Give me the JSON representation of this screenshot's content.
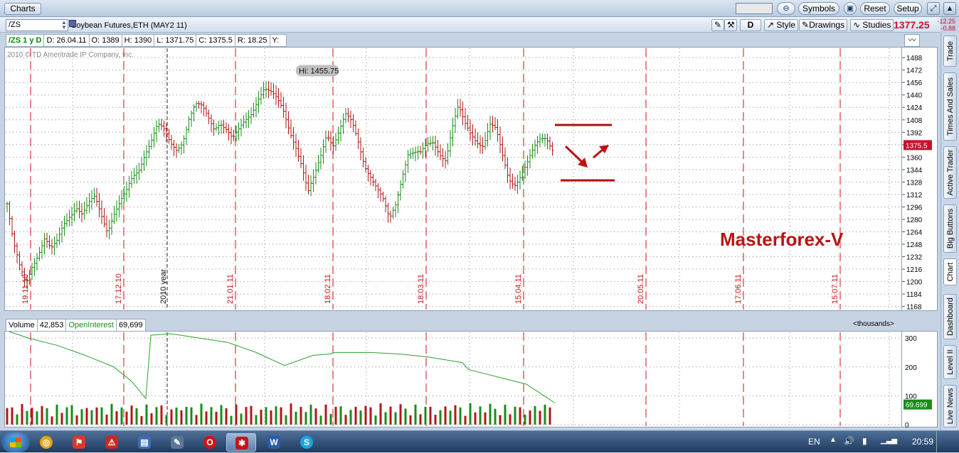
{
  "window": {
    "tab_label": "Charts",
    "buttons": {
      "symbols": "Symbols",
      "reset": "Reset",
      "setup": "Setup"
    }
  },
  "toolbar": {
    "symbol_value": "/ZS",
    "description": "Soybean Futures,ETH (MAY2 11)",
    "period": "D",
    "style": "Style",
    "drawings": "Drawings",
    "studies": "Studies",
    "last_price": "1377.25",
    "net_change": "-12.25",
    "pct_change": "-0.88 %"
  },
  "info": {
    "symbol": "/ZS 1 y D",
    "date": "D: 26.04.11",
    "open": "O: 1389",
    "high": "H: 1390",
    "low": "L: 1371.75",
    "close": "C: 1375.5",
    "range": "R: 18.25",
    "y": "Y:"
  },
  "copyright": "2010 © TD Ameritrade IP Company, Inc.",
  "high_label": "Hi: 1455.75",
  "watermark": "Masterforex-V",
  "price_badge": "1375.5",
  "volume_info": {
    "label": "Volume",
    "value": "42,853",
    "oi_label": "OpenInterest",
    "oi_value": "69,699",
    "units": "<thousands>",
    "oi_badge": "69.699"
  },
  "right_tabs": [
    "Trade",
    "Times And Sales",
    "Active Trader",
    "Big Buttons",
    "Chart",
    "Dashboard",
    "Level II",
    "Live News"
  ],
  "taskbar": {
    "lang": "EN",
    "time": "20:59"
  },
  "colors": {
    "up": "#1a8c1a",
    "down": "#b01818",
    "marker": "#d01010",
    "oi": "#2e9e2e",
    "watermark": "#b81414"
  },
  "chart_data": [
    {
      "type": "candlestick",
      "title": "Soybean Futures,ETH (MAY2 11)",
      "y_ticks": [
        1488,
        1472,
        1456,
        1440,
        1424,
        1408,
        1392,
        1376,
        1360,
        1344,
        1328,
        1312,
        1296,
        1280,
        1264,
        1248,
        1232,
        1216,
        1200,
        1184,
        1168
      ],
      "ylim": [
        1164,
        1500
      ],
      "date_markers": [
        "19.11.10",
        "17.12.10",
        "21.01.11",
        "18.02.11",
        "18.03.11",
        "15.04.11",
        "20.05.11",
        "17.06.11",
        "15.07.11"
      ],
      "year_marker": "2010 year",
      "price_path": [
        1300,
        1245,
        1215,
        1198,
        1225,
        1240,
        1255,
        1236,
        1248,
        1275,
        1290,
        1300,
        1285,
        1295,
        1305,
        1288,
        1270,
        1290,
        1300,
        1310,
        1330,
        1345,
        1370,
        1385,
        1400,
        1390,
        1375,
        1372,
        1385,
        1412,
        1425,
        1420,
        1410,
        1400,
        1410,
        1398,
        1380,
        1390,
        1405,
        1420,
        1440,
        1450,
        1440,
        1430,
        1420,
        1400,
        1380,
        1350,
        1310,
        1330,
        1360,
        1395,
        1380,
        1395,
        1410,
        1400,
        1380,
        1355,
        1340,
        1320,
        1300,
        1275,
        1300,
        1340,
        1370,
        1365,
        1360,
        1372,
        1380,
        1370,
        1360,
        1395,
        1420,
        1400,
        1392,
        1385,
        1378,
        1400,
        1390,
        1360,
        1335,
        1330,
        1340,
        1350,
        1365,
        1380,
        1388,
        1376
      ],
      "high": 1455.75,
      "last": 1375.5
    },
    {
      "type": "bar",
      "title": "Volume / OpenInterest",
      "y_ticks": [
        300,
        200,
        100,
        0
      ],
      "ylim": [
        0,
        320
      ],
      "volume_pattern": [
        72,
        50,
        38,
        62,
        45,
        55,
        40,
        68,
        48,
        35,
        58,
        44,
        52,
        65,
        30,
        47,
        60,
        42
      ],
      "open_interest": [
        325,
        300,
        275,
        240,
        200,
        150,
        90,
        310,
        315,
        300,
        285,
        250,
        205,
        240,
        245,
        250,
        250,
        245,
        235,
        215,
        200,
        190,
        140,
        75
      ],
      "last_oi": 69.699
    }
  ]
}
